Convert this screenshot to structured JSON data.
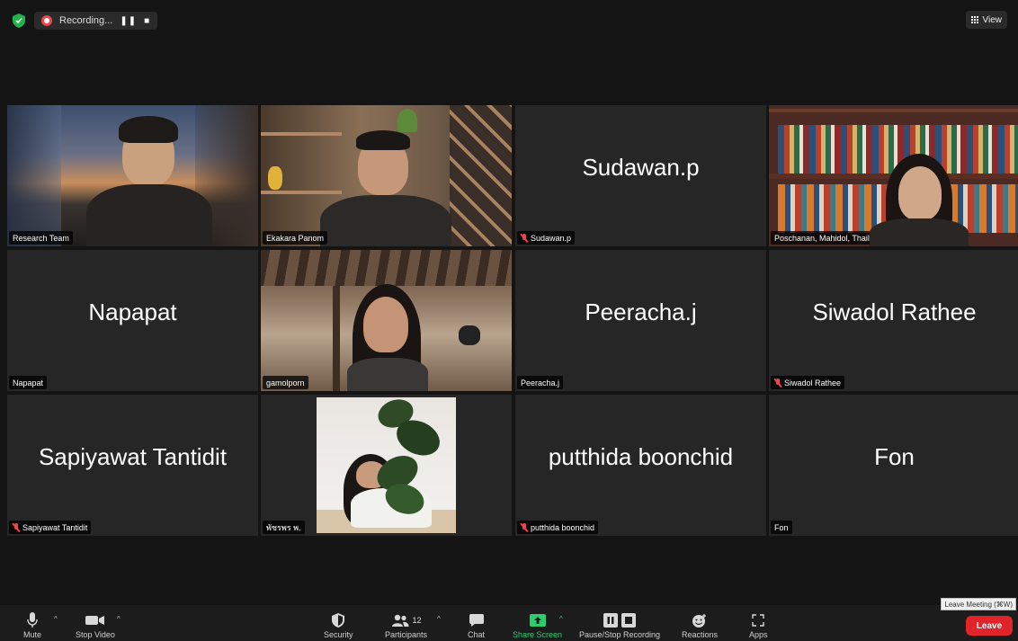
{
  "topbar": {
    "recording_label": "Recording...",
    "pause_glyph": "❚❚",
    "stop_glyph": "■",
    "view_label": "View"
  },
  "tiles": [
    {
      "name": "Research Team",
      "video": true,
      "muted": false
    },
    {
      "name": "Ekakara Panom",
      "video": true,
      "muted": false
    },
    {
      "name": "Sudawan.p",
      "video": false,
      "muted": true
    },
    {
      "name": "Poschanan, Mahidol, Thailand",
      "video": true,
      "muted": false
    },
    {
      "name": "Napapat",
      "video": false,
      "muted": false
    },
    {
      "name": "gamolporn",
      "video": true,
      "muted": false
    },
    {
      "name": "Peeracha.j",
      "video": false,
      "muted": false
    },
    {
      "name": "Siwadol Rathee",
      "video": false,
      "muted": true
    },
    {
      "name": "Sapiyawat Tantidit",
      "video": false,
      "muted": true
    },
    {
      "name": "พัชรพร พ.",
      "video": true,
      "muted": false,
      "active": true
    },
    {
      "name": "putthida boonchid",
      "video": false,
      "muted": true
    },
    {
      "name": "Fon",
      "video": false,
      "muted": false
    }
  ],
  "toolbar": {
    "mute": "Mute",
    "stop_video": "Stop Video",
    "security": "Security",
    "participants": "Participants",
    "participants_count": "12",
    "chat": "Chat",
    "share_screen": "Share Screen",
    "pause_stop_recording": "Pause/Stop Recording",
    "reactions": "Reactions",
    "apps": "Apps",
    "leave": "Leave",
    "leave_tooltip": "Leave Meeting (⌘W)"
  },
  "colors": {
    "accent_green": "#2ecc71",
    "leave_red": "#e0242a",
    "active_speaker": "#c5d86d",
    "record_red": "#e8474d"
  }
}
